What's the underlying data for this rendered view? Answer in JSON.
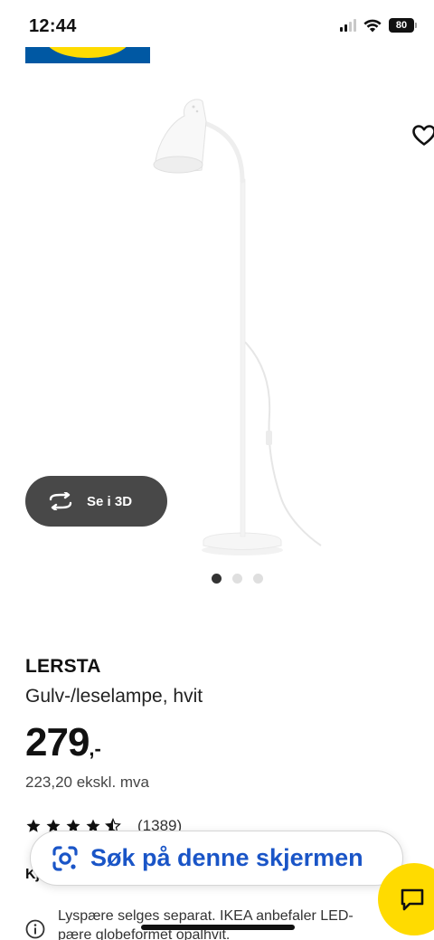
{
  "status_bar": {
    "time": "12:44",
    "battery": "80"
  },
  "gallery": {
    "view3d_label": "Se i 3D",
    "image_count": 3,
    "active_image": 1
  },
  "product": {
    "name": "LERSTA",
    "description": "Gulv-/leselampe, hvit",
    "price": "279",
    "price_suffix": ",-",
    "price_ex_vat": "223,20 ekskl. mva",
    "rating": 4.5,
    "review_count": "(1389)",
    "info_text": "Lyspære selges separat. IKEA anbefaler LED-pære globeformet opalhvit."
  },
  "kj_label": "Kj",
  "lens": {
    "label": "Søk på denne skjermen"
  },
  "colors": {
    "ikea_blue": "#0058a3",
    "ikea_yellow": "#ffdb00",
    "lens_blue": "#1a55c7"
  }
}
